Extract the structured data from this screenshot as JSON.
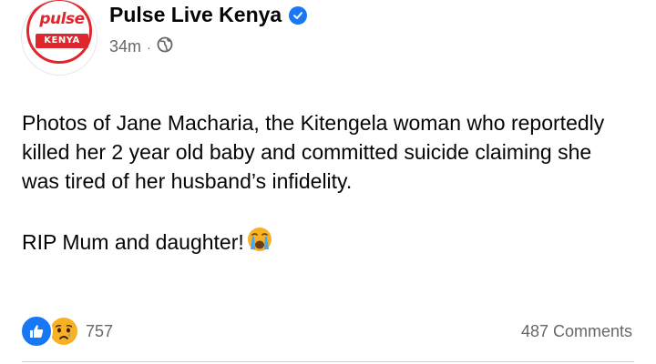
{
  "header": {
    "page_name": "Pulse Live Kenya",
    "time": "34m",
    "separator": "·",
    "privacy_icon": "globe-icon",
    "verified_icon": "verified-badge-icon",
    "logo": {
      "brand": "pulse",
      "country": "KENYA"
    }
  },
  "post": {
    "paragraph1": "Photos of Jane Macharia, the Kitengela woman who reportedly killed her 2 year old baby and committed suicide claiming she was tired of her husband’s infidelity.",
    "paragraph2": "RIP Mum and daughter!",
    "emoji": "loudly-crying-face-icon"
  },
  "footer": {
    "reaction_icons": [
      "like-icon",
      "sad-icon"
    ],
    "reaction_count": "757",
    "comments": "487 Comments"
  },
  "colors": {
    "brand_red": "#e0262d",
    "facebook_blue": "#1877f2",
    "secondary_text": "#65676b",
    "sad_yellow": "#f7b125"
  }
}
